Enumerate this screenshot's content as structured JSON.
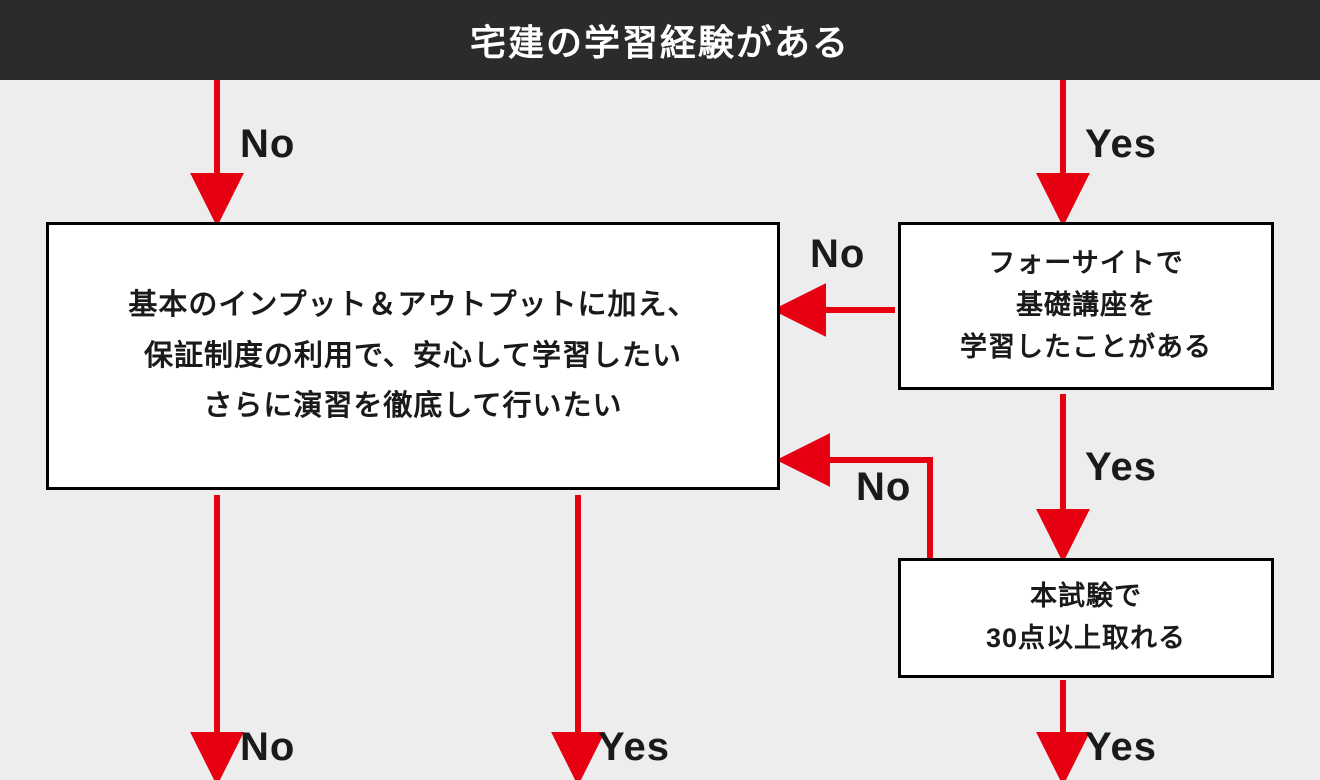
{
  "header": {
    "title": "宅建の学習経験がある"
  },
  "nodes": {
    "left_box": {
      "line1": "基本のインプット＆アウトプットに加え、",
      "line2": "保証制度の利用で、安心して学習したい",
      "line3": "さらに演習を徹底して行いたい"
    },
    "right_box_1": {
      "line1": "フォーサイトで",
      "line2": "基礎講座を",
      "line3": "学習したことがある"
    },
    "right_box_2": {
      "line1": "本試験で",
      "line2": "30点以上取れる"
    }
  },
  "labels": {
    "no": "No",
    "yes": "Yes"
  }
}
